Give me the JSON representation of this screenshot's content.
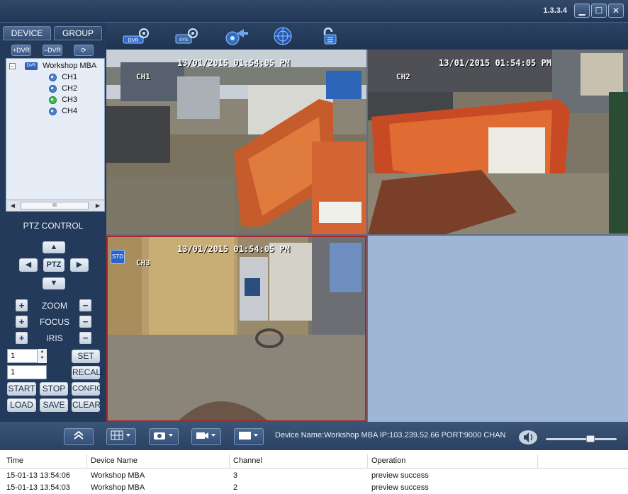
{
  "app": {
    "version": "1.3.3.4"
  },
  "window_controls": {
    "minimize": "▁",
    "maximize": "☐",
    "close": "✕"
  },
  "sidebar": {
    "tabs": [
      {
        "label": "DEVICE"
      },
      {
        "label": "GROUP"
      }
    ],
    "tree_tools": [
      "+",
      "−",
      "⟳"
    ],
    "tree": {
      "device": "Workshop MBA",
      "channels": [
        "CH1",
        "CH2",
        "CH3",
        "CH4"
      ],
      "scroll_thumb": "III"
    }
  },
  "ptz": {
    "title": "PTZ CONTROL",
    "center": "PTZ",
    "zoom": "ZOOM",
    "focus": "FOCUS",
    "iris": "IRIS",
    "preset_value": "1",
    "speed_value": "1",
    "buttons": {
      "set": "SET",
      "recall": "RECALL",
      "start": "START",
      "stop": "STOP",
      "config": "CONFIG",
      "load": "LOAD",
      "save": "SAVE",
      "clear": "CLEAR"
    }
  },
  "toolbar": {
    "dvr_badge": "DVR",
    "sys_badge": "SYS"
  },
  "tiles": [
    {
      "timestamp": "13/01/2015 01:54:05 PM",
      "channel": "CH1"
    },
    {
      "timestamp": "13/01/2015 01:54:05 PM",
      "channel": "CH2"
    },
    {
      "timestamp": "13/01/2015 01:54:05 PM",
      "channel": "CH3",
      "badge": "STD"
    }
  ],
  "status_bar": {
    "device_info": "Device Name:Workshop MBA   IP:103.239.52.66   PORT:9000   CHAN",
    "volume_level": 0.65
  },
  "log": {
    "columns": [
      "Time",
      "Device Name",
      "Channel",
      "Operation"
    ],
    "rows": [
      [
        "15-01-13 13:54:06",
        "Workshop MBA",
        "3",
        "preview success"
      ],
      [
        "15-01-13 13:54:03",
        "Workshop MBA",
        "2",
        "preview success"
      ]
    ]
  },
  "colors": {
    "panel": "#243a5a",
    "accent": "#b0232a",
    "empty_tile": "#9fb6d6"
  }
}
